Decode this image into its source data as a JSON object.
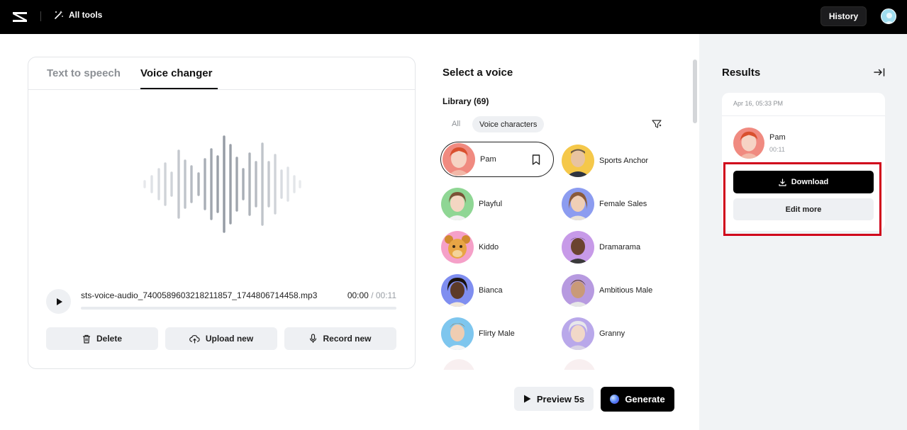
{
  "topbar": {
    "all_tools_label": "All tools",
    "history_label": "History"
  },
  "left_card": {
    "tabs": [
      {
        "label": "Text to speech",
        "active": false
      },
      {
        "label": "Voice changer",
        "active": true
      }
    ],
    "player": {
      "filename": "sts-voice-audio_7400589603218211857_1744806714458.mp3",
      "current_time": "00:00",
      "total_time": "/ 00:11",
      "progress": 0
    },
    "actions": {
      "delete_label": "Delete",
      "upload_label": "Upload new",
      "record_label": "Record new"
    }
  },
  "voice_panel": {
    "title": "Select a voice",
    "library_label": "Library (69)",
    "filters": {
      "all_label": "All",
      "active_label": "Voice characters"
    },
    "voices": [
      {
        "name": "Pam",
        "selected": true,
        "color": "#f08a80"
      },
      {
        "name": "Sports Anchor",
        "selected": false,
        "color": "#f5c84a"
      },
      {
        "name": "Playful",
        "selected": false,
        "color": "#8fd694"
      },
      {
        "name": "Female Sales",
        "selected": false,
        "color": "#8c9cf0"
      },
      {
        "name": "Kiddo",
        "selected": false,
        "color": "#f5a0c8"
      },
      {
        "name": "Dramarama",
        "selected": false,
        "color": "#c79ae8"
      },
      {
        "name": "Bianca",
        "selected": false,
        "color": "#7f8ef0"
      },
      {
        "name": "Ambitious Male",
        "selected": false,
        "color": "#b79ae0"
      },
      {
        "name": "Flirty Male",
        "selected": false,
        "color": "#7ec6ee"
      },
      {
        "name": "Granny",
        "selected": false,
        "color": "#b9a8ea"
      }
    ],
    "preview_label": "Preview 5s",
    "generate_label": "Generate"
  },
  "results": {
    "title": "Results",
    "item": {
      "date": "Apr 16, 05:33 PM",
      "voice_name": "Pam",
      "duration": "00:11"
    },
    "download_label": "Download",
    "edit_more_label": "Edit more"
  }
}
